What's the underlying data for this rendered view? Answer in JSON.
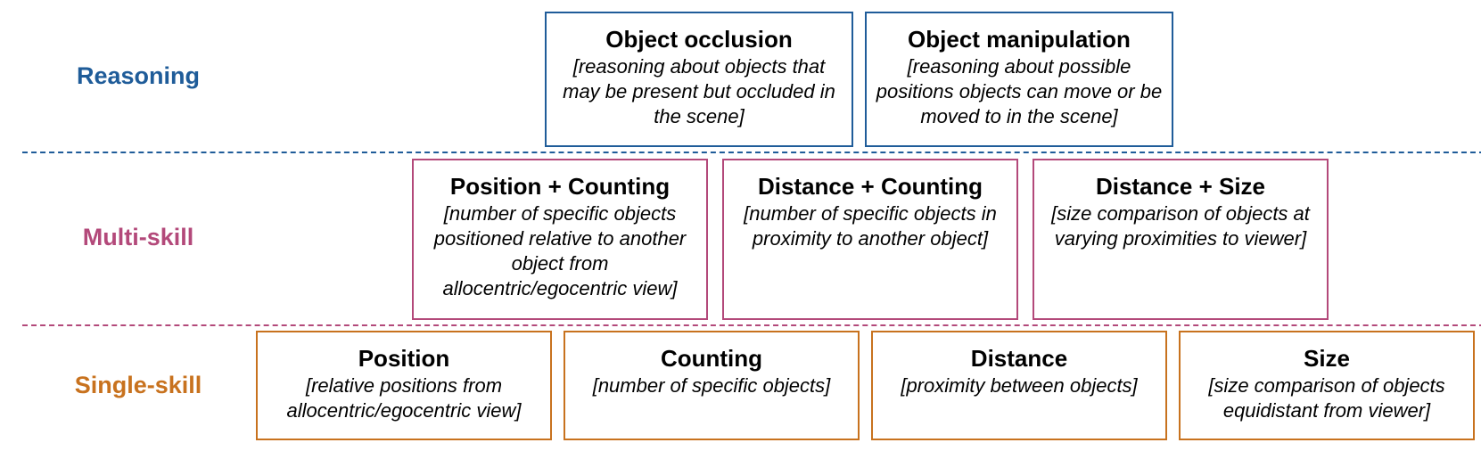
{
  "colors": {
    "reasoning": "#1f5c99",
    "multi_skill": "#b3497a",
    "single_skill": "#c8721e"
  },
  "tiers": {
    "reasoning": {
      "label": "Reasoning",
      "boxes": [
        {
          "title": "Object occlusion",
          "desc": "[reasoning about objects that may be present but occluded in the scene]"
        },
        {
          "title": "Object manipulation",
          "desc": "[reasoning about possible positions objects can move or be moved to in the scene]"
        }
      ]
    },
    "multi_skill": {
      "label": "Multi-skill",
      "boxes": [
        {
          "title": "Position + Counting",
          "desc": "[number of specific objects positioned relative to another object from allocentric/egocentric view]"
        },
        {
          "title": "Distance + Counting",
          "desc": "[number of specific objects in proximity to another object]"
        },
        {
          "title": "Distance + Size",
          "desc": "[size comparison of objects at varying proximities to viewer]"
        }
      ]
    },
    "single_skill": {
      "label": "Single-skill",
      "boxes": [
        {
          "title": "Position",
          "desc": "[relative positions from allocentric/egocentric view]"
        },
        {
          "title": "Counting",
          "desc": "[number of specific objects]"
        },
        {
          "title": "Distance",
          "desc": "[proximity between objects]"
        },
        {
          "title": "Size",
          "desc": "[size comparison of objects equidistant from viewer]"
        }
      ]
    }
  }
}
